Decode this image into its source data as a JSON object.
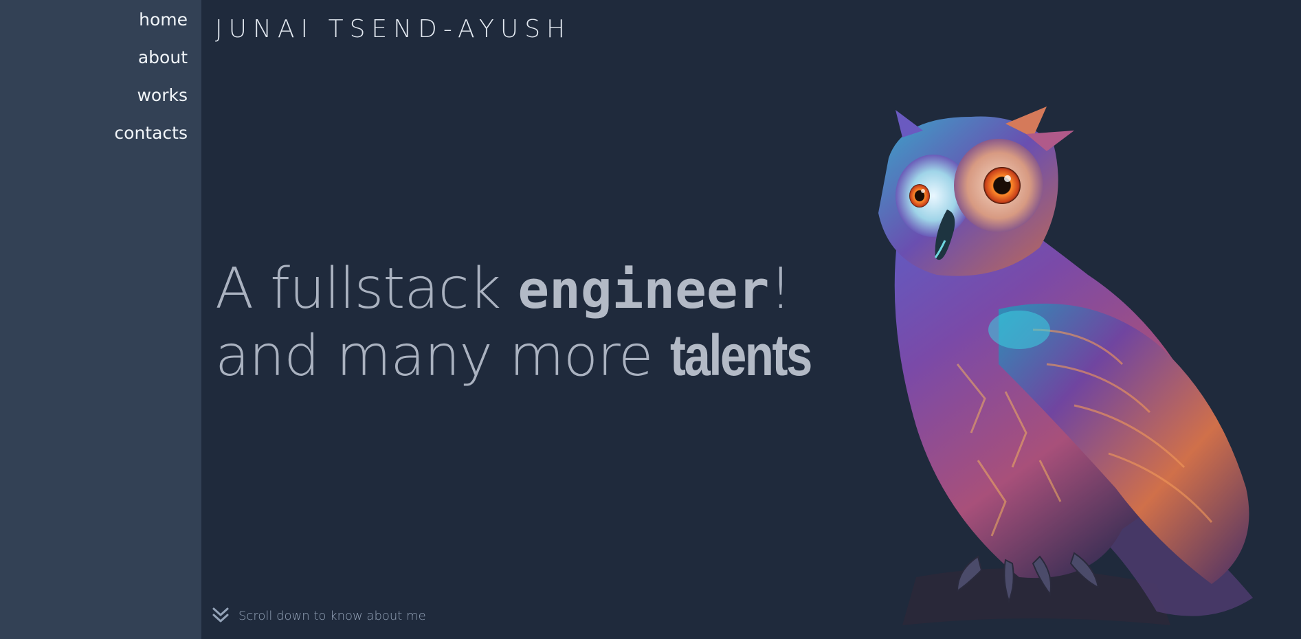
{
  "nav": {
    "items": [
      {
        "label": "home"
      },
      {
        "label": "about"
      },
      {
        "label": "works"
      },
      {
        "label": "contacts"
      }
    ]
  },
  "header": {
    "title": "JUNAI TSEND-AYUSH"
  },
  "hero": {
    "line1_prefix": "A fullstack ",
    "line1_emphasis": "engineer",
    "line1_suffix": "!",
    "line2_prefix": "and many more ",
    "line2_emphasis": "talents"
  },
  "scroll_hint": {
    "text": "Scroll down to know about me",
    "icon": "double-chevron-down-icon"
  },
  "illustration": {
    "subject": "owl-illustration"
  },
  "colors": {
    "sidebar_bg": "#334155",
    "main_bg": "#1f2a3c",
    "hero_text": "#aab2c0"
  }
}
